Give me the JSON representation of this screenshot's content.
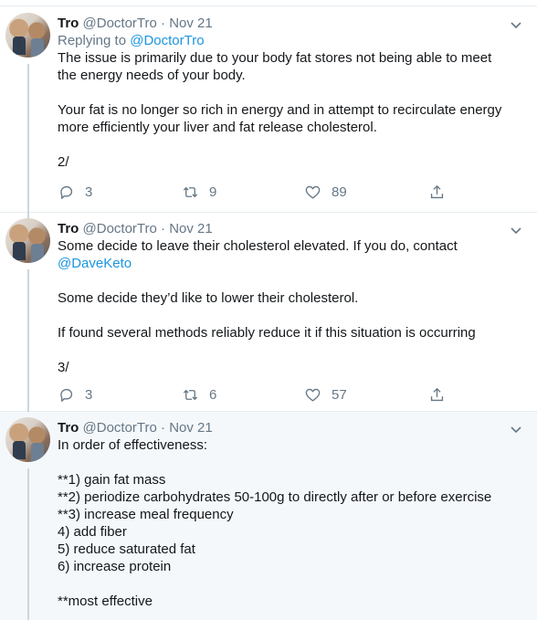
{
  "tweets": [
    {
      "name": "Tro",
      "handle": "@DoctorTro",
      "separator": "·",
      "date": "Nov 21",
      "replying_prefix": "Replying to ",
      "replying_to": "@DoctorTro",
      "lines": [
        "The issue is primarily due to your body fat stores not being able to meet",
        "the energy needs of your body.",
        "",
        "Your fat is no longer so rich in energy and in attempt to recirculate energy",
        "more efficiently your liver and fat release cholesterol.",
        "",
        "2/"
      ],
      "replies": "3",
      "retweets": "9",
      "likes": "89"
    },
    {
      "name": "Tro",
      "handle": "@DoctorTro",
      "separator": "·",
      "date": "Nov 21",
      "lines": [
        "Some decide to leave their cholesterol elevated. If you do, contact",
        "@DaveKeto",
        "",
        "Some decide they’d like to lower their cholesterol.",
        "",
        "If found several methods reliably reduce it if this situation is occurring",
        "",
        "3/"
      ],
      "replies": "3",
      "retweets": "6",
      "likes": "57"
    },
    {
      "name": "Tro",
      "handle": "@DoctorTro",
      "separator": "·",
      "date": "Nov 21",
      "lines": [
        "In order of effectiveness:",
        "",
        "**1) gain fat mass",
        "**2) periodize carbohydrates 50-100g to directly after or before exercise",
        "**3) increase meal frequency",
        "4) add fiber",
        "5) reduce saturated fat",
        "6) increase protein",
        "",
        "**most effective"
      ]
    }
  ],
  "icons": {
    "reply": "reply-icon",
    "retweet": "retweet-icon",
    "like": "heart-icon",
    "share": "share-icon",
    "menu": "chevron-down-icon"
  },
  "colors": {
    "link": "#1b95e0",
    "muted": "#657786",
    "text": "#14171a",
    "highlight_bg": "#f5f8fa"
  }
}
